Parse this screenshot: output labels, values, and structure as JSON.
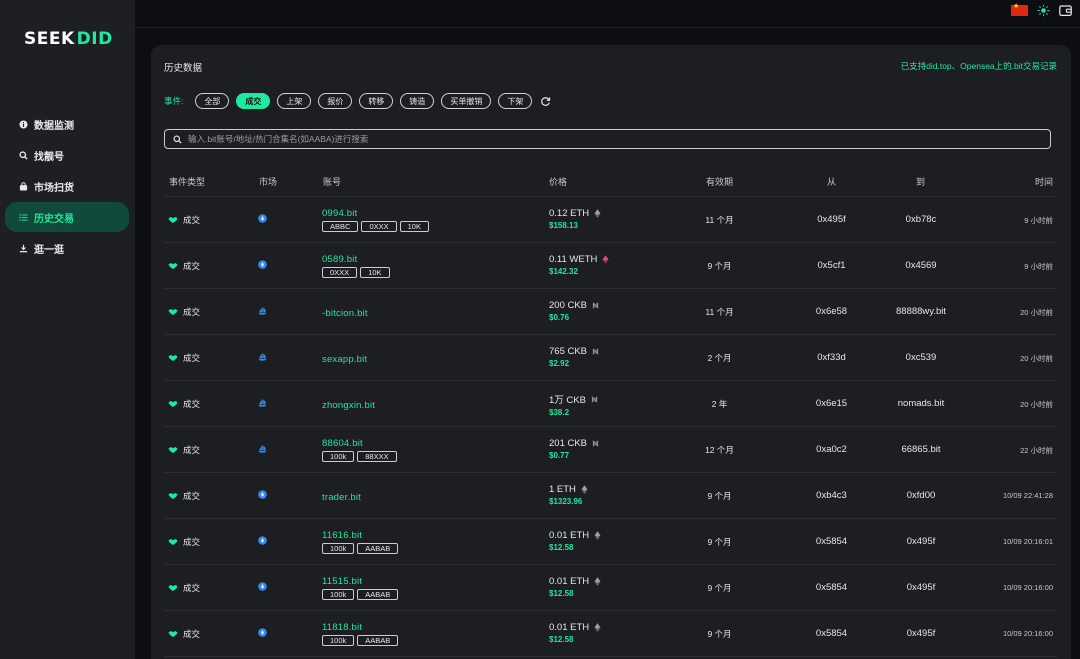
{
  "brand": {
    "logo_left": "SEEK",
    "logo_right": "DID"
  },
  "sidebar": {
    "items": [
      {
        "label": "数据监测",
        "icon": "info-icon",
        "active": false
      },
      {
        "label": "找靓号",
        "icon": "search-icon",
        "active": false
      },
      {
        "label": "市场扫货",
        "icon": "bag-icon",
        "active": false
      },
      {
        "label": "历史交易",
        "icon": "list-icon",
        "active": true
      },
      {
        "label": "逛一逛",
        "icon": "download-icon",
        "active": false
      }
    ]
  },
  "topbar": {
    "flag": "china-flag-icon",
    "theme": "sun-icon",
    "wallet": "wallet-icon"
  },
  "panel": {
    "title": "历史数据",
    "note": "已支持did.top、Opensea上的.bit交易记录",
    "filters_label": "事件:",
    "filters": [
      "全部",
      "成交",
      "上架",
      "报价",
      "转移",
      "铸造",
      "买单撤销",
      "下架"
    ],
    "active_filter": "成交",
    "search_placeholder": "输入.bit账号/地址/热门合集名(如AABA)进行搜索"
  },
  "table": {
    "headers": {
      "type": "事件类型",
      "market": "市场",
      "account": "账号",
      "price": "价格",
      "validity": "有效期",
      "from": "从",
      "to": "到",
      "time": "时间"
    },
    "rows": [
      {
        "type": "成交",
        "market": "did-top",
        "account": "0994.bit",
        "tags": [
          "ABBC",
          "0XXX",
          "10K"
        ],
        "price": "0.12 ETH",
        "coin": "eth",
        "usd": "$158.13",
        "validity": "11 个月",
        "from": "0x495f",
        "to": "0xb78c",
        "time": "9 小时前"
      },
      {
        "type": "成交",
        "market": "did-top",
        "account": "0589.bit",
        "tags": [
          "0XXX",
          "10K"
        ],
        "price": "0.11 WETH",
        "coin": "weth",
        "usd": "$142.32",
        "validity": "9 个月",
        "from": "0x5cf1",
        "to": "0x4569",
        "time": "9 小时前"
      },
      {
        "type": "成交",
        "market": "opensea",
        "account": "-bitcion.bit",
        "tags": [],
        "price": "200 CKB",
        "coin": "ckb",
        "usd": "$0.76",
        "validity": "11 个月",
        "from": "0x6e58",
        "to": "88888wy.bit",
        "time": "20 小时前"
      },
      {
        "type": "成交",
        "market": "opensea",
        "account": "sexapp.bit",
        "tags": [],
        "price": "765 CKB",
        "coin": "ckb",
        "usd": "$2.92",
        "validity": "2 个月",
        "from": "0xf33d",
        "to": "0xc539",
        "time": "20 小时前"
      },
      {
        "type": "成交",
        "market": "opensea",
        "account": "zhongxin.bit",
        "tags": [],
        "price": "1万 CKB",
        "coin": "ckb",
        "usd": "$38.2",
        "validity": "2 年",
        "from": "0x6e15",
        "to": "nomads.bit",
        "time": "20 小时前"
      },
      {
        "type": "成交",
        "market": "opensea",
        "account": "88604.bit",
        "tags": [
          "100k",
          "88XXX"
        ],
        "price": "201 CKB",
        "coin": "ckb",
        "usd": "$0.77",
        "validity": "12 个月",
        "from": "0xa0c2",
        "to": "66865.bit",
        "time": "22 小时前"
      },
      {
        "type": "成交",
        "market": "did-top",
        "account": "trader.bit",
        "tags": [],
        "price": "1 ETH",
        "coin": "eth",
        "usd": "$1323.96",
        "validity": "9 个月",
        "from": "0xb4c3",
        "to": "0xfd00",
        "time": "10/09 22:41:28"
      },
      {
        "type": "成交",
        "market": "did-top",
        "account": "11616.bit",
        "tags": [
          "100k",
          "AABAB"
        ],
        "price": "0.01 ETH",
        "coin": "eth",
        "usd": "$12.58",
        "validity": "9 个月",
        "from": "0x5854",
        "to": "0x495f",
        "time": "10/09 20:16:01"
      },
      {
        "type": "成交",
        "market": "did-top",
        "account": "11515.bit",
        "tags": [
          "100k",
          "AABAB"
        ],
        "price": "0.01 ETH",
        "coin": "eth",
        "usd": "$12.58",
        "validity": "9 个月",
        "from": "0x5854",
        "to": "0x495f",
        "time": "10/09 20:16:00"
      },
      {
        "type": "成交",
        "market": "did-top",
        "account": "11818.bit",
        "tags": [
          "100k",
          "AABAB"
        ],
        "price": "0.01 ETH",
        "coin": "eth",
        "usd": "$12.58",
        "validity": "9 个月",
        "from": "0x5854",
        "to": "0x495f",
        "time": "10/09 20:16:00"
      }
    ]
  },
  "colors": {
    "accent": "#1de9a0",
    "active_nav_bg": "#0f4a3b",
    "sidebar_bg": "#1d1f23",
    "panel_bg": "#1c1e22",
    "page_bg": "#0d0e11"
  }
}
